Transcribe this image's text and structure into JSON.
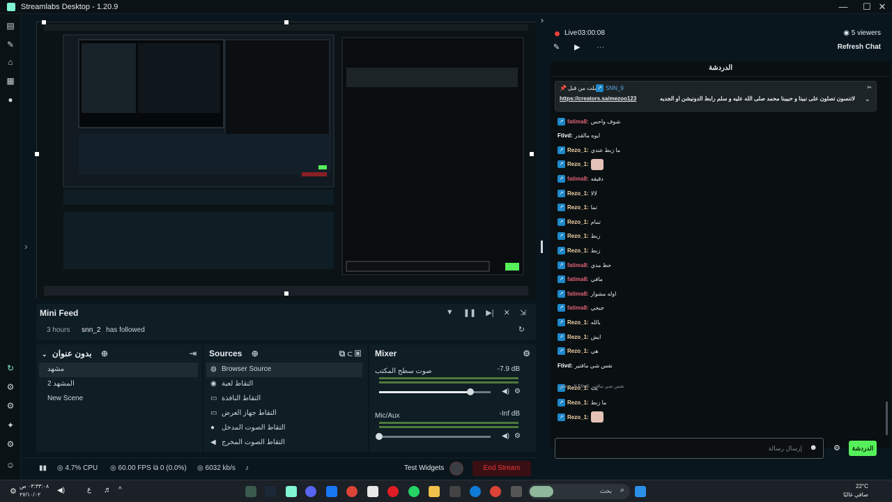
{
  "window": {
    "title": "Streamlabs Desktop - 1.20.9",
    "minimize": "—",
    "maximize": "☐",
    "close": "✕"
  },
  "mini_feed": {
    "title": "Mini Feed",
    "time": "3 hours",
    "user": "snn_2",
    "action": "has followed"
  },
  "scenes": {
    "title": "بدون عنوان",
    "items": [
      "مشهد",
      "المشهد 2",
      "New Scene"
    ]
  },
  "sources": {
    "title": "Sources",
    "items": [
      "Browser Source",
      "التقاط لعبة",
      "التقاط النافذة",
      "التقاط جهاز العرض",
      "التقاط الصوت المدخل",
      "التقاط الصوت المخرج"
    ]
  },
  "mixer": {
    "title": "Mixer",
    "channels": [
      {
        "name": "صوت سطح المكتب",
        "db": "-7.9 dB",
        "level": 0.82
      },
      {
        "name": "Mic/Aux",
        "db": "-Inf dB",
        "level": 0.0
      }
    ]
  },
  "status": {
    "cpu": "4.7% CPU",
    "fps": "60.00 FPS",
    "dropped": "0 (0.0%)",
    "bitrate": "6032 kb/s",
    "test_widgets": "Test Widgets",
    "end_stream": "End Stream"
  },
  "chat": {
    "live_label": "Live",
    "live_time": "03:00:08",
    "viewers": "5 viewers",
    "refresh": "Refresh Chat",
    "title": "الدردشة",
    "pinned_by": "أرسلت من قبل",
    "pinned_user": "SNN_9",
    "pinned_link": "https://creators.sa/mezoo123",
    "pinned_text": "لاتنسون تصلون على نبينا و حبيبنا محمد صلى الله عليه و سلم رابط الدونيشن او الجديه يحي:",
    "messages": [
      {
        "user": "fatima8",
        "color": "#e06377",
        "text": "شوف واحس",
        "badge": true
      },
      {
        "user": "Ftivd",
        "color": "#ffffff",
        "text": "ايوه مالقدر",
        "badge": false
      },
      {
        "user": "Rezo_1",
        "color": "#f5d7a8",
        "text": "ما زبط عندي",
        "badge": true
      },
      {
        "user": "Rezo_1",
        "color": "#f5d7a8",
        "text": "",
        "badge": true,
        "emote": true
      },
      {
        "user": "fatima8",
        "color": "#e06377",
        "text": "دقيقه",
        "badge": true
      },
      {
        "user": "Rezo_1",
        "color": "#f5d7a8",
        "text": "لالا",
        "badge": true
      },
      {
        "user": "Rezo_1",
        "color": "#f5d7a8",
        "text": "تما",
        "badge": true
      },
      {
        "user": "Rezo_1",
        "color": "#f5d7a8",
        "text": "تمام",
        "badge": true
      },
      {
        "user": "Rezo_1",
        "color": "#f5d7a8",
        "text": "زبط",
        "badge": true
      },
      {
        "user": "Rezo_1",
        "color": "#f5d7a8",
        "text": "زبط",
        "badge": true
      },
      {
        "user": "fatima8",
        "color": "#e06377",
        "text": "حظ مدي",
        "badge": true
      },
      {
        "user": "fatima8",
        "color": "#e06377",
        "text": "مافي",
        "badge": true
      },
      {
        "user": "fatima8",
        "color": "#e06377",
        "text": "اوله مشوار",
        "badge": true
      },
      {
        "user": "fatima8",
        "color": "#e06377",
        "text": "جيجي",
        "badge": true
      },
      {
        "user": "Rezo_1",
        "color": "#f5d7a8",
        "text": "بالله",
        "badge": true
      },
      {
        "user": "Rezo_1",
        "color": "#f5d7a8",
        "text": "ايش",
        "badge": true
      },
      {
        "user": "Rezo_1",
        "color": "#f5d7a8",
        "text": "هي",
        "badge": true
      },
      {
        "user": "Ftivd",
        "color": "#ffffff",
        "text": "نفس شي مافتير",
        "badge": false
      },
      {
        "user": "Rezo_1",
        "color": "#f5d7a8",
        "text": "يب",
        "badge": true
      },
      {
        "user": "Rezo_1",
        "color": "#f5d7a8",
        "text": "ما زبط",
        "badge": true
      },
      {
        "user": "Rezo_1",
        "color": "#f5d7a8",
        "text": "",
        "badge": true,
        "emote": true
      }
    ],
    "reply_note": "الرد على Ftivd: نفس شي مافتير",
    "input_placeholder": "إرسال رسالة",
    "send_label": "الدردشة"
  },
  "taskbar": {
    "search_placeholder": "بحث",
    "time": "٠٣:٣٣:٠٨ ص",
    "date": "٢٧/١٠/٠٢",
    "lang": "ع",
    "weather": "22°C",
    "weather_desc": "صافي غالبًا"
  }
}
